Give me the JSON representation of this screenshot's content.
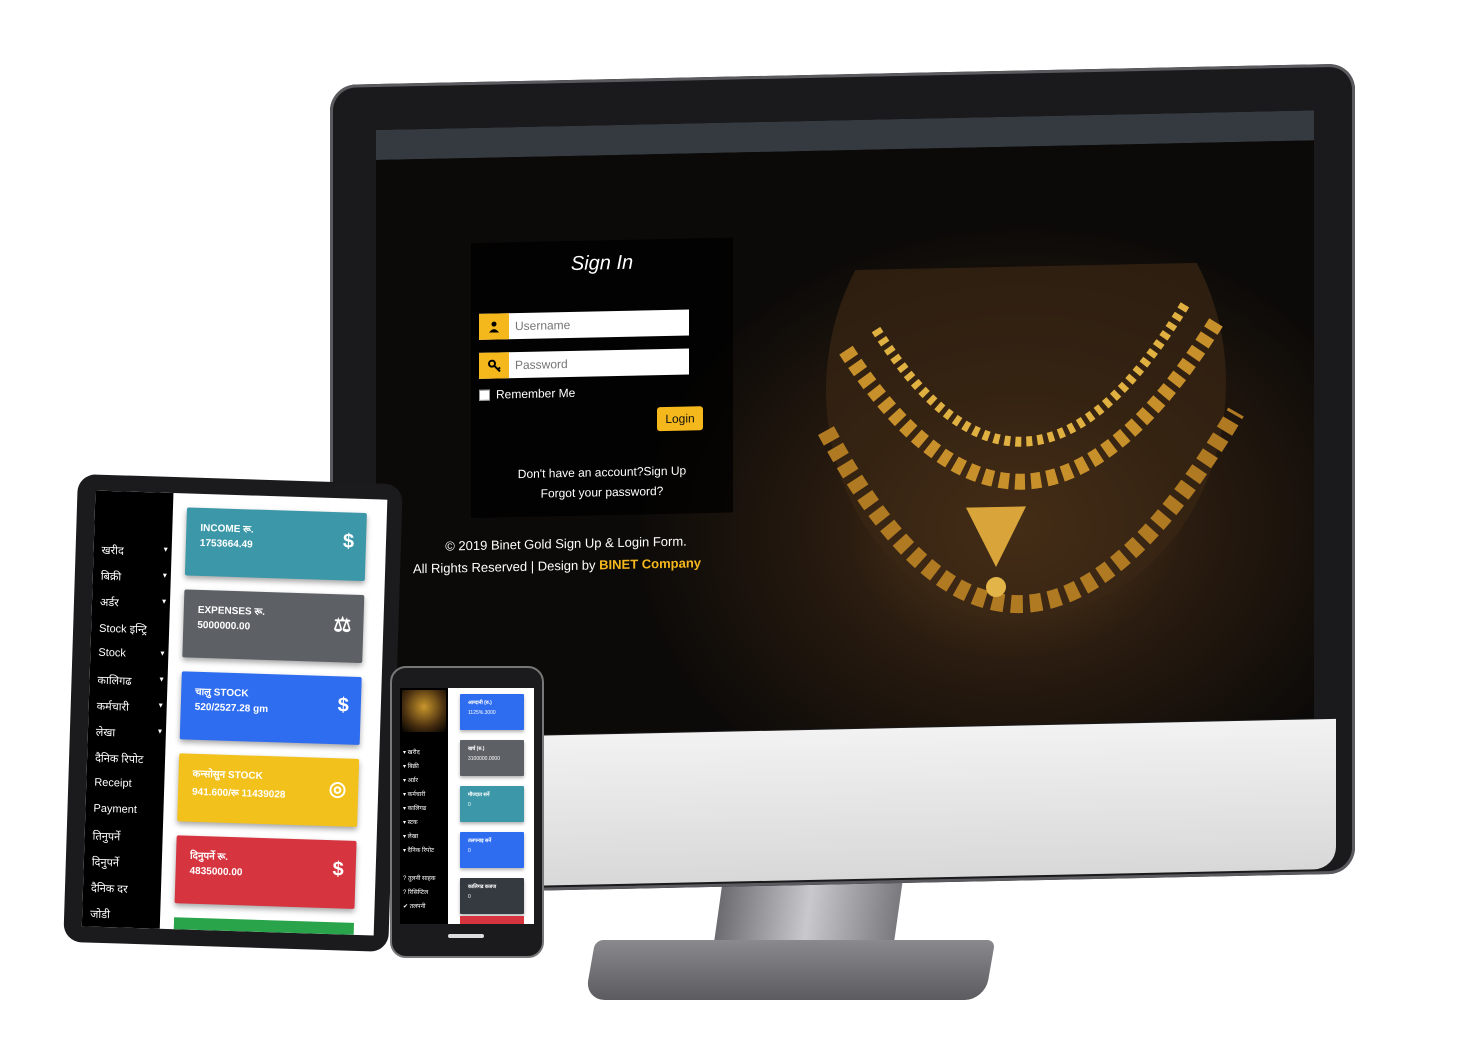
{
  "colors": {
    "accent": "#f5b81c",
    "teal": "#3c98a9",
    "gray": "#5d6166",
    "blue": "#2f6df0",
    "yellow": "#f3c11b",
    "red": "#d6343f",
    "green": "#2aa44a",
    "navbar": "#343a40"
  },
  "signin": {
    "title": "Sign In",
    "username_placeholder": "Username",
    "password_placeholder": "Password",
    "remember_label": "Remember Me",
    "login_label": "Login",
    "signup_text": "Don't have an account?Sign Up",
    "forgot_text": "Forgot your password?",
    "user_icon": "user-icon",
    "key_icon": "key-icon"
  },
  "footer": {
    "line1": "© 2019 Binet Gold Sign Up & Login Form.",
    "line2": "All Rights Reserved | Design by",
    "brand": "BINET Company"
  },
  "tablet": {
    "nav": [
      {
        "label": "खरीद",
        "caret": "▾"
      },
      {
        "label": "बिक्री",
        "caret": "▾"
      },
      {
        "label": "अर्डर",
        "caret": "▾"
      },
      {
        "label": "Stock इन्ट्रि",
        "caret": ""
      },
      {
        "label": "Stock",
        "caret": "▾"
      },
      {
        "label": "कालिगढ",
        "caret": "▾"
      },
      {
        "label": "कर्मचारी",
        "caret": "▾"
      },
      {
        "label": "लेखा",
        "caret": "▾"
      },
      {
        "label": "दैनिक रिपोट",
        "caret": ""
      },
      {
        "label": "Receipt",
        "caret": ""
      },
      {
        "label": "Payment",
        "caret": ""
      },
      {
        "label": "तिनुपर्ने",
        "caret": ""
      },
      {
        "label": "दिनुपर्ने",
        "caret": ""
      },
      {
        "label": "दैनिक दर",
        "caret": ""
      },
      {
        "label": "जोडी",
        "caret": ""
      }
    ],
    "cards": [
      {
        "title": "INCOME रू.",
        "value": "1753664.49",
        "icon": "$"
      },
      {
        "title": "EXPENSES रू.",
        "value": "5000000.00",
        "icon": "⚖"
      },
      {
        "title": "चालु STOCK",
        "value": "520/2527.28 gm",
        "icon": "$"
      },
      {
        "title": "कन्सोसुन STOCK",
        "value": "941.600/रू 11439028",
        "icon": "◎"
      },
      {
        "title": "दिनुपर्ने रू.",
        "value": "4835000.00",
        "icon": "$"
      }
    ]
  },
  "phone": {
    "nav": [
      "▾ खरीद",
      "▾ बिक्री",
      "▾ अर्डर",
      "▾ कर्मचारी",
      "▾ कालिगढ",
      "▾ स्टक",
      "▾ लेखा",
      "▾ दैनिक रिपोट",
      "? तुलनी साहक",
      "? रिसिप्टिल",
      "✔ तलपनी"
    ],
    "cards": [
      {
        "title": "आम्दानी (रु.)",
        "value": "1125%.3000"
      },
      {
        "title": "खर्च (रु.)",
        "value": "3100000.0000"
      },
      {
        "title": "मौज्दात सर्ने",
        "value": "0"
      },
      {
        "title": "तलपनाइ सर्ने",
        "value": "0"
      },
      {
        "title": "कालिगढ कजज",
        "value": "0"
      }
    ]
  }
}
